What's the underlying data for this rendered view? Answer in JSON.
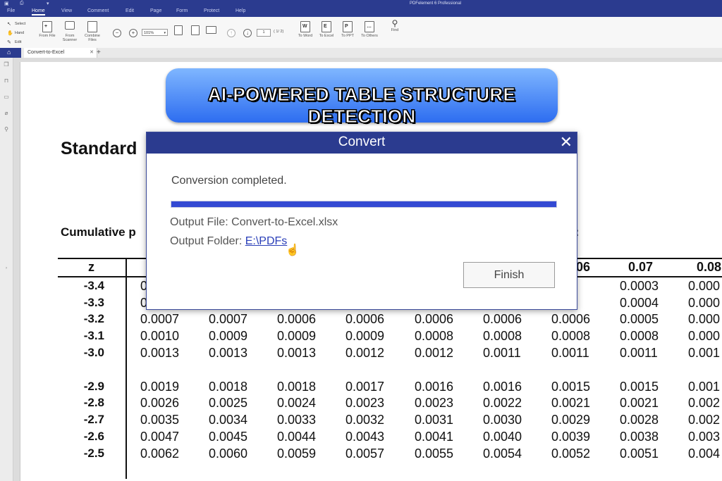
{
  "app": {
    "title": "PDFelement 6 Professional"
  },
  "menu": {
    "items": [
      "File",
      "Home",
      "View",
      "Comment",
      "Edit",
      "Page",
      "Form",
      "Protect",
      "Help"
    ],
    "active": "Home"
  },
  "ribbon": {
    "select_label": "Select",
    "hand_label": "Hand",
    "edit_label": "Edit",
    "from_file_label": "From File",
    "from_scanner_label": "From Scanner",
    "combine_files_label": "Combine Files",
    "zoom_value": "101%",
    "page_current": "1",
    "page_total": "( 1/ 2)",
    "to_word_label": "To Word",
    "to_excel_label": "To Excel",
    "to_ppt_label": "To PPT",
    "to_others_label": "To Others",
    "find_label": "Find"
  },
  "tabs": {
    "doc_name": "Convert-to-Excel"
  },
  "banner": {
    "text": "AI-POWERED TABLE STRUCTURE DETECTION"
  },
  "document": {
    "title": "Standard",
    "subtitle_left": "Cumulative p",
    "subtitle_right": "e:",
    "header": {
      "z": "z",
      "col_06": "06",
      "col_07": "0.07",
      "col_08": "0.08"
    },
    "rows": [
      {
        "z": "-3.4",
        "values": [
          "0",
          "",
          "",
          "",
          "",
          "",
          "003",
          "0.0003",
          "0.000"
        ]
      },
      {
        "z": "-3.3",
        "values": [
          "0",
          "",
          "",
          "",
          "",
          "",
          "004",
          "0.0004",
          "0.000"
        ]
      },
      {
        "z": "-3.2",
        "values": [
          "0.0007",
          "0.0007",
          "0.0006",
          "0.0006",
          "0.0006",
          "0.0006",
          "0.0006",
          "0.0005",
          "0.000"
        ]
      },
      {
        "z": "-3.1",
        "values": [
          "0.0010",
          "0.0009",
          "0.0009",
          "0.0009",
          "0.0008",
          "0.0008",
          "0.0008",
          "0.0008",
          "0.000"
        ]
      },
      {
        "z": "-3.0",
        "values": [
          "0.0013",
          "0.0013",
          "0.0013",
          "0.0012",
          "0.0012",
          "0.0011",
          "0.0011",
          "0.0011",
          "0.001"
        ]
      },
      {
        "z": "-2.9",
        "values": [
          "0.0019",
          "0.0018",
          "0.0018",
          "0.0017",
          "0.0016",
          "0.0016",
          "0.0015",
          "0.0015",
          "0.001"
        ]
      },
      {
        "z": "-2.8",
        "values": [
          "0.0026",
          "0.0025",
          "0.0024",
          "0.0023",
          "0.0023",
          "0.0022",
          "0.0021",
          "0.0021",
          "0.002"
        ]
      },
      {
        "z": "-2.7",
        "values": [
          "0.0035",
          "0.0034",
          "0.0033",
          "0.0032",
          "0.0031",
          "0.0030",
          "0.0029",
          "0.0028",
          "0.002"
        ]
      },
      {
        "z": "-2.6",
        "values": [
          "0.0047",
          "0.0045",
          "0.0044",
          "0.0043",
          "0.0041",
          "0.0040",
          "0.0039",
          "0.0038",
          "0.003"
        ]
      },
      {
        "z": "-2.5",
        "values": [
          "0.0062",
          "0.0060",
          "0.0059",
          "0.0057",
          "0.0055",
          "0.0054",
          "0.0052",
          "0.0051",
          "0.004"
        ]
      }
    ]
  },
  "dialog": {
    "title": "Convert",
    "message": "Conversion completed.",
    "progress": 1.0,
    "output_file": "Output File: Convert-to-Excel.xlsx",
    "output_folder_label": "Output Folder: ",
    "output_folder_link": "E:\\PDFs",
    "finish_label": "Finish"
  },
  "colors": {
    "titlebar": "#2b3b8f",
    "progress": "#3349d3",
    "banner": "#3f7ff5"
  }
}
